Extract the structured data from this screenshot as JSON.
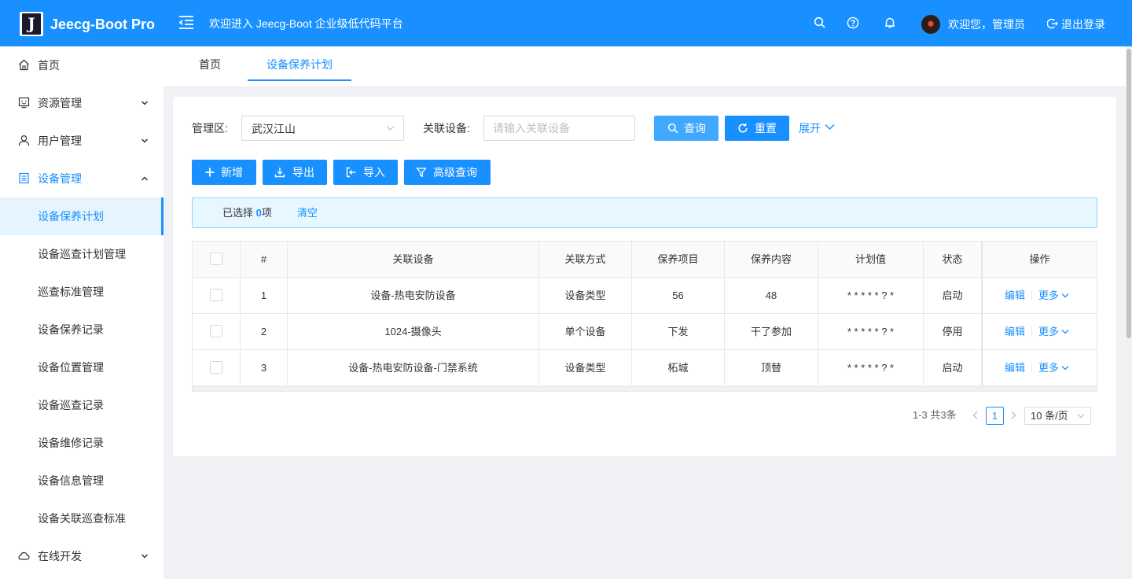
{
  "app": {
    "name": "Jeecg-Boot Pro",
    "logo_letter": "J",
    "header_title": "欢迎进入 Jeecg-Boot 企业级低代码平台",
    "welcome_user": "欢迎您，管理员",
    "logout": "退出登录",
    "brand_color": "#1890ff"
  },
  "sidebar": {
    "items": [
      {
        "label": "首页",
        "icon": "home-icon"
      },
      {
        "label": "资源管理",
        "icon": "monitor-icon"
      },
      {
        "label": "用户管理",
        "icon": "user-icon"
      },
      {
        "label": "设备管理",
        "icon": "document-icon"
      },
      {
        "label": "设备保养计划"
      },
      {
        "label": "设备巡查计划管理"
      },
      {
        "label": "巡查标准管理"
      },
      {
        "label": "设备保养记录"
      },
      {
        "label": "设备位置管理"
      },
      {
        "label": "设备巡查记录"
      },
      {
        "label": "设备维修记录"
      },
      {
        "label": "设备信息管理"
      },
      {
        "label": "设备关联巡查标准"
      },
      {
        "label": "在线开发",
        "icon": "cloud-icon"
      }
    ]
  },
  "tabs": [
    {
      "label": "首页"
    },
    {
      "label": "设备保养计划",
      "active": true
    }
  ],
  "search": {
    "area_label": "管理区:",
    "area_value": "武汉江山",
    "device_label": "关联设备:",
    "device_placeholder": "请输入关联设备",
    "query_btn": "查询",
    "reset_btn": "重置",
    "expand": "展开"
  },
  "toolbar": {
    "add": "新增",
    "export": "导出",
    "import": "导入",
    "advanced": "高级查询"
  },
  "selection": {
    "prefix": "已选择",
    "count": "0",
    "suffix": "项",
    "clear": "清空"
  },
  "table": {
    "columns": [
      "#",
      "关联设备",
      "关联方式",
      "保养项目",
      "保养内容",
      "计划值",
      "状态",
      "操作"
    ],
    "rows": [
      {
        "no": "1",
        "device": "设备-热电安防设备",
        "mode": "设备类型",
        "item": "56",
        "content": "48",
        "plan": "* * * * * ? *",
        "status": "启动"
      },
      {
        "no": "2",
        "device": "1024-摄像头",
        "mode": "单个设备",
        "item": "下发",
        "content": "干了参加",
        "plan": "* * * * * ? *",
        "status": "停用"
      },
      {
        "no": "3",
        "device": "设备-热电安防设备-门禁系统",
        "mode": "设备类型",
        "item": "柘城",
        "content": "顶替",
        "plan": "* * * * * ? *",
        "status": "启动"
      }
    ],
    "edit": "编辑",
    "more": "更多"
  },
  "pagination": {
    "total_text": "1-3 共3条",
    "current": "1",
    "page_size": "10 条/页"
  }
}
